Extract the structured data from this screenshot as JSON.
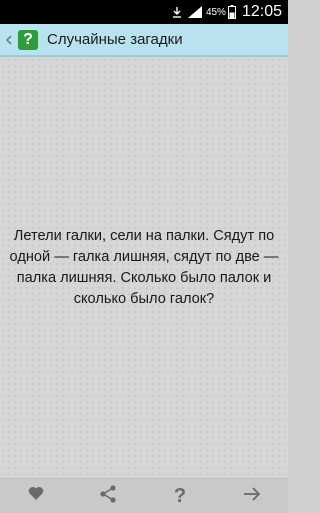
{
  "status_bar": {
    "battery_percent": "45%",
    "time": "12:05",
    "icons": [
      "download-icon",
      "signal-icon",
      "battery-icon"
    ]
  },
  "action_bar": {
    "title": "Случайные загадки",
    "back_icon": "chevron-left-icon",
    "app_icon": "question-icon",
    "app_icon_glyph": "?",
    "accent_color": "#b8e3ee",
    "app_icon_color": "#2f9c3d"
  },
  "riddle": {
    "text": "Летели галки, сели на палки. Сядут по одной — галка лишняя, сядут по две — палка лишняя. Сколько было палок и сколько было галок?"
  },
  "bottom_bar": {
    "buttons": [
      {
        "icon": "heart-icon"
      },
      {
        "icon": "share-icon"
      },
      {
        "icon": "question-icon",
        "glyph": "?"
      },
      {
        "icon": "arrow-right-icon"
      }
    ]
  }
}
